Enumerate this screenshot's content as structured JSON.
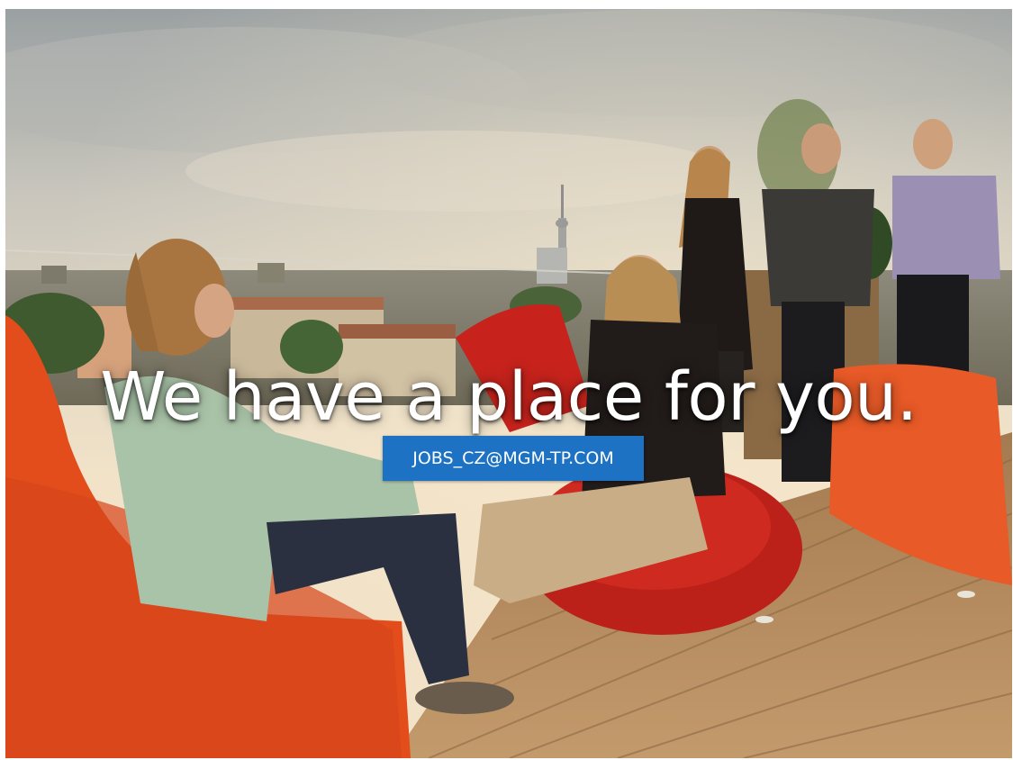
{
  "hero": {
    "headline": "We have a place for you.",
    "cta_label": "JOBS_CZ@MGM-TP.COM"
  },
  "colors": {
    "cta_background": "#1d72c4",
    "headline_text": "#ffffff",
    "beanbag_orange": "#e8511f",
    "beanbag_red": "#c4231c",
    "deck_wood": "#b58a5c"
  },
  "photo_subjects": [
    "rooftop-terrace",
    "beanbags",
    "city-skyline",
    "tv-tower",
    "people-chatting"
  ]
}
